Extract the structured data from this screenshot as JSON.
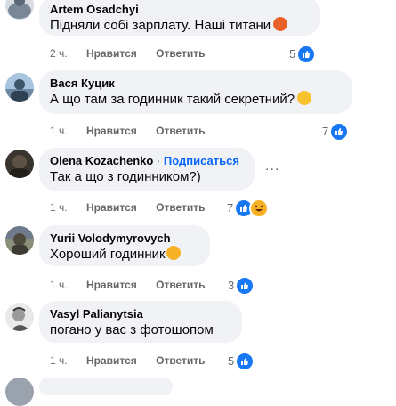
{
  "comments": [
    {
      "author": "Artem Osadchyi",
      "text": "Підняли собі зарплату. Наші титани",
      "time": "2 ч.",
      "like": "Нравится",
      "reply": "Ответить",
      "reactions": "5",
      "emoji": "angry-face-icon"
    },
    {
      "author": "Вася Куцик",
      "text": "А що там за годинник такий секретний?",
      "time": "1 ч.",
      "like": "Нравится",
      "reply": "Ответить",
      "reactions": "7",
      "emoji": "thinking-face-icon"
    },
    {
      "author": "Olena Kozachenko",
      "follow": "Подписаться",
      "separator": "·",
      "text": "Так а що з годинником?)",
      "time": "1 ч.",
      "like": "Нравится",
      "reply": "Ответить",
      "reactions": "7"
    },
    {
      "author": "Yurii Volodymyrovych",
      "text": "Хороший годинник",
      "time": "1 ч.",
      "like": "Нравится",
      "reply": "Ответить",
      "reactions": "3",
      "emoji": "laughing-face-icon"
    },
    {
      "author": "Vasyl Palianytsia",
      "text": "погано у вас з фотошопом",
      "time": "1 ч.",
      "like": "Нравится",
      "reply": "Ответить",
      "reactions": "5"
    }
  ],
  "more_menu": "...",
  "colors": {
    "bubble": "#f0f2f5",
    "secondary_text": "#65676b",
    "like_blue": "#1877f2",
    "follow_blue": "#0866ff"
  }
}
